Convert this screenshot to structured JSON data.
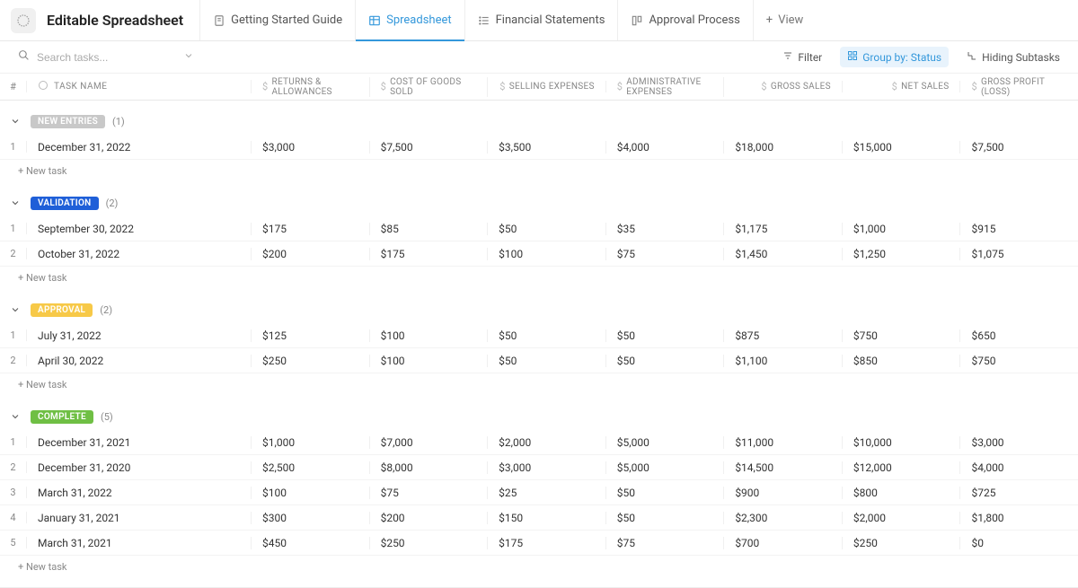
{
  "header": {
    "title": "Editable Spreadsheet",
    "tabs": [
      {
        "label": "Getting Started Guide"
      },
      {
        "label": "Spreadsheet"
      },
      {
        "label": "Financial Statements"
      },
      {
        "label": "Approval Process"
      }
    ],
    "add_view": "View"
  },
  "toolbar": {
    "search_placeholder": "Search tasks...",
    "filter": "Filter",
    "group_by": "Group by: Status",
    "hiding": "Hiding Subtasks"
  },
  "columns": {
    "num": "#",
    "name": "TASK NAME",
    "c1": "RETURNS & ALLOWANCES",
    "c2": "COST OF GOODS SOLD",
    "c3": "SELLING EXPENSES",
    "c4": "ADMINISTRATIVE EXPENSES",
    "c5": "GROSS SALES",
    "c6": "NET SALES",
    "c7": "GROSS PROFIT (LOSS)"
  },
  "groups": [
    {
      "label": "NEW ENTRIES",
      "badge_class": "badge-new",
      "count": "(1)",
      "rows": [
        {
          "num": "1",
          "name": "December 31, 2022",
          "c1": "$3,000",
          "c2": "$7,500",
          "c3": "$3,500",
          "c4": "$4,000",
          "c5": "$18,000",
          "c6": "$15,000",
          "c7": "$7,500"
        }
      ]
    },
    {
      "label": "VALIDATION",
      "badge_class": "badge-validation",
      "count": "(2)",
      "rows": [
        {
          "num": "1",
          "name": "September 30, 2022",
          "c1": "$175",
          "c2": "$85",
          "c3": "$50",
          "c4": "$35",
          "c5": "$1,175",
          "c6": "$1,000",
          "c7": "$915"
        },
        {
          "num": "2",
          "name": "October 31, 2022",
          "c1": "$200",
          "c2": "$175",
          "c3": "$100",
          "c4": "$75",
          "c5": "$1,450",
          "c6": "$1,250",
          "c7": "$1,075"
        }
      ]
    },
    {
      "label": "APPROVAL",
      "badge_class": "badge-approval",
      "count": "(2)",
      "rows": [
        {
          "num": "1",
          "name": "July 31, 2022",
          "c1": "$125",
          "c2": "$100",
          "c3": "$50",
          "c4": "$50",
          "c5": "$875",
          "c6": "$750",
          "c7": "$650"
        },
        {
          "num": "2",
          "name": "April 30, 2022",
          "c1": "$250",
          "c2": "$100",
          "c3": "$50",
          "c4": "$50",
          "c5": "$1,100",
          "c6": "$850",
          "c7": "$750"
        }
      ]
    },
    {
      "label": "COMPLETE",
      "badge_class": "badge-complete",
      "count": "(5)",
      "rows": [
        {
          "num": "1",
          "name": "December 31, 2021",
          "c1": "$1,000",
          "c2": "$7,000",
          "c3": "$2,000",
          "c4": "$5,000",
          "c5": "$11,000",
          "c6": "$10,000",
          "c7": "$3,000"
        },
        {
          "num": "2",
          "name": "December 31, 2020",
          "c1": "$2,500",
          "c2": "$8,000",
          "c3": "$3,000",
          "c4": "$5,000",
          "c5": "$14,500",
          "c6": "$12,000",
          "c7": "$4,000"
        },
        {
          "num": "3",
          "name": "March 31, 2022",
          "c1": "$100",
          "c2": "$75",
          "c3": "$25",
          "c4": "$50",
          "c5": "$900",
          "c6": "$800",
          "c7": "$725"
        },
        {
          "num": "4",
          "name": "January 31, 2021",
          "c1": "$300",
          "c2": "$200",
          "c3": "$150",
          "c4": "$50",
          "c5": "$2,300",
          "c6": "$2,000",
          "c7": "$1,800"
        },
        {
          "num": "5",
          "name": "March 31, 2021",
          "c1": "$450",
          "c2": "$250",
          "c3": "$175",
          "c4": "$75",
          "c5": "$700",
          "c6": "$250",
          "c7": "$0"
        }
      ]
    }
  ],
  "new_task": "+ New task"
}
